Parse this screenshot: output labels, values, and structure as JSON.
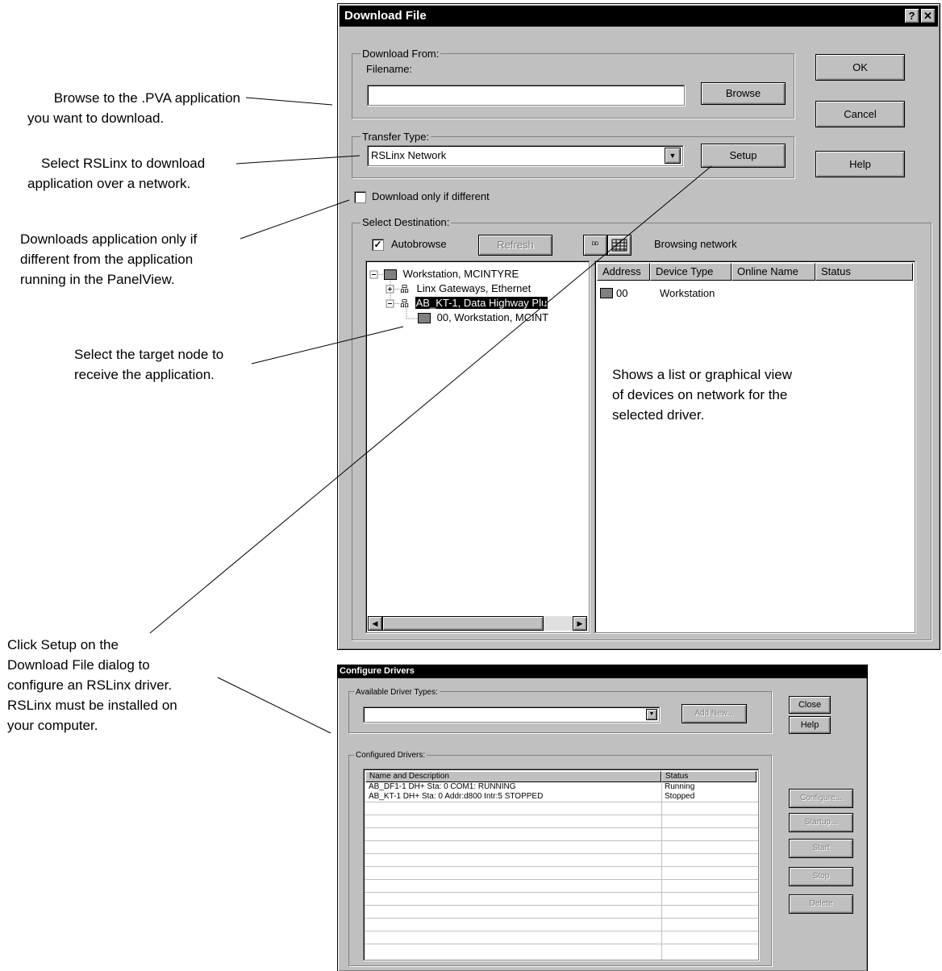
{
  "callouts": {
    "browse": [
      "Browse to the .PVA application",
      "you want to download."
    ],
    "select_rslinx": [
      "Select RSLinx to download",
      "application over a network."
    ],
    "download_diff": [
      "Downloads application only if",
      "different from the application",
      "running in the PanelView."
    ],
    "target_node": [
      "Select the target node to",
      "receive the application."
    ],
    "click_setup": [
      "Click Setup on the",
      "Download File dialog to",
      "configure an RSLinx driver.",
      "RSLinx must be installed on",
      "your computer."
    ],
    "shows_list": [
      "Shows a list or graphical view",
      "of devices on network for the",
      "selected driver."
    ]
  },
  "download_dialog": {
    "title": "Download File",
    "help_btn": "?",
    "close_btn": "✕",
    "download_from_label": "Download From:",
    "filename_label": "Filename:",
    "filename_value": "",
    "browse_button": "Browse",
    "ok_button": "OK",
    "cancel_button": "Cancel",
    "help_button": "Help",
    "transfer_type_label": "Transfer Type:",
    "transfer_type_value": "RSLinx Network",
    "setup_button": "Setup",
    "download_only_if_different": "Download only if different",
    "download_only_checked": false,
    "select_destination_label": "Select Destination:",
    "autobrowse_label": "Autobrowse",
    "autobrowse_checked": true,
    "refresh_button": "Refresh",
    "browsing_status": "Browsing network",
    "tree": {
      "root": "Workstation, MCINTYRE",
      "child1": "Linx Gateways, Ethernet",
      "child2": "AB_KT-1, Data Highway Plu",
      "grandchild": "00, Workstation, MCINT"
    },
    "columns": [
      "Address",
      "Device Type",
      "Online Name",
      "Status"
    ],
    "devices": [
      {
        "address": "00",
        "device_type": "Workstation",
        "online_name": "",
        "status": ""
      }
    ]
  },
  "configure_dialog": {
    "title": "Configure Drivers",
    "available_label": "Available Driver Types:",
    "available_value": "",
    "add_new_button": "Add New...",
    "close_button": "Close",
    "help_button": "Help",
    "configured_label": "Configured Drivers:",
    "col_name": "Name and Description",
    "col_status": "Status",
    "drivers": [
      {
        "name": "AB_DF1-1 DH+ Sta: 0 COM1: RUNNING",
        "status": "Running"
      },
      {
        "name": "AB_KT-1 DH+ Sta: 0 Addr:d800 Intr:5 STOPPED",
        "status": "Stopped"
      }
    ],
    "configure_button": "Configure...",
    "startup_button": "Startup...",
    "start_button": "Start",
    "stop_button": "Stop",
    "delete_button": "Delete"
  }
}
